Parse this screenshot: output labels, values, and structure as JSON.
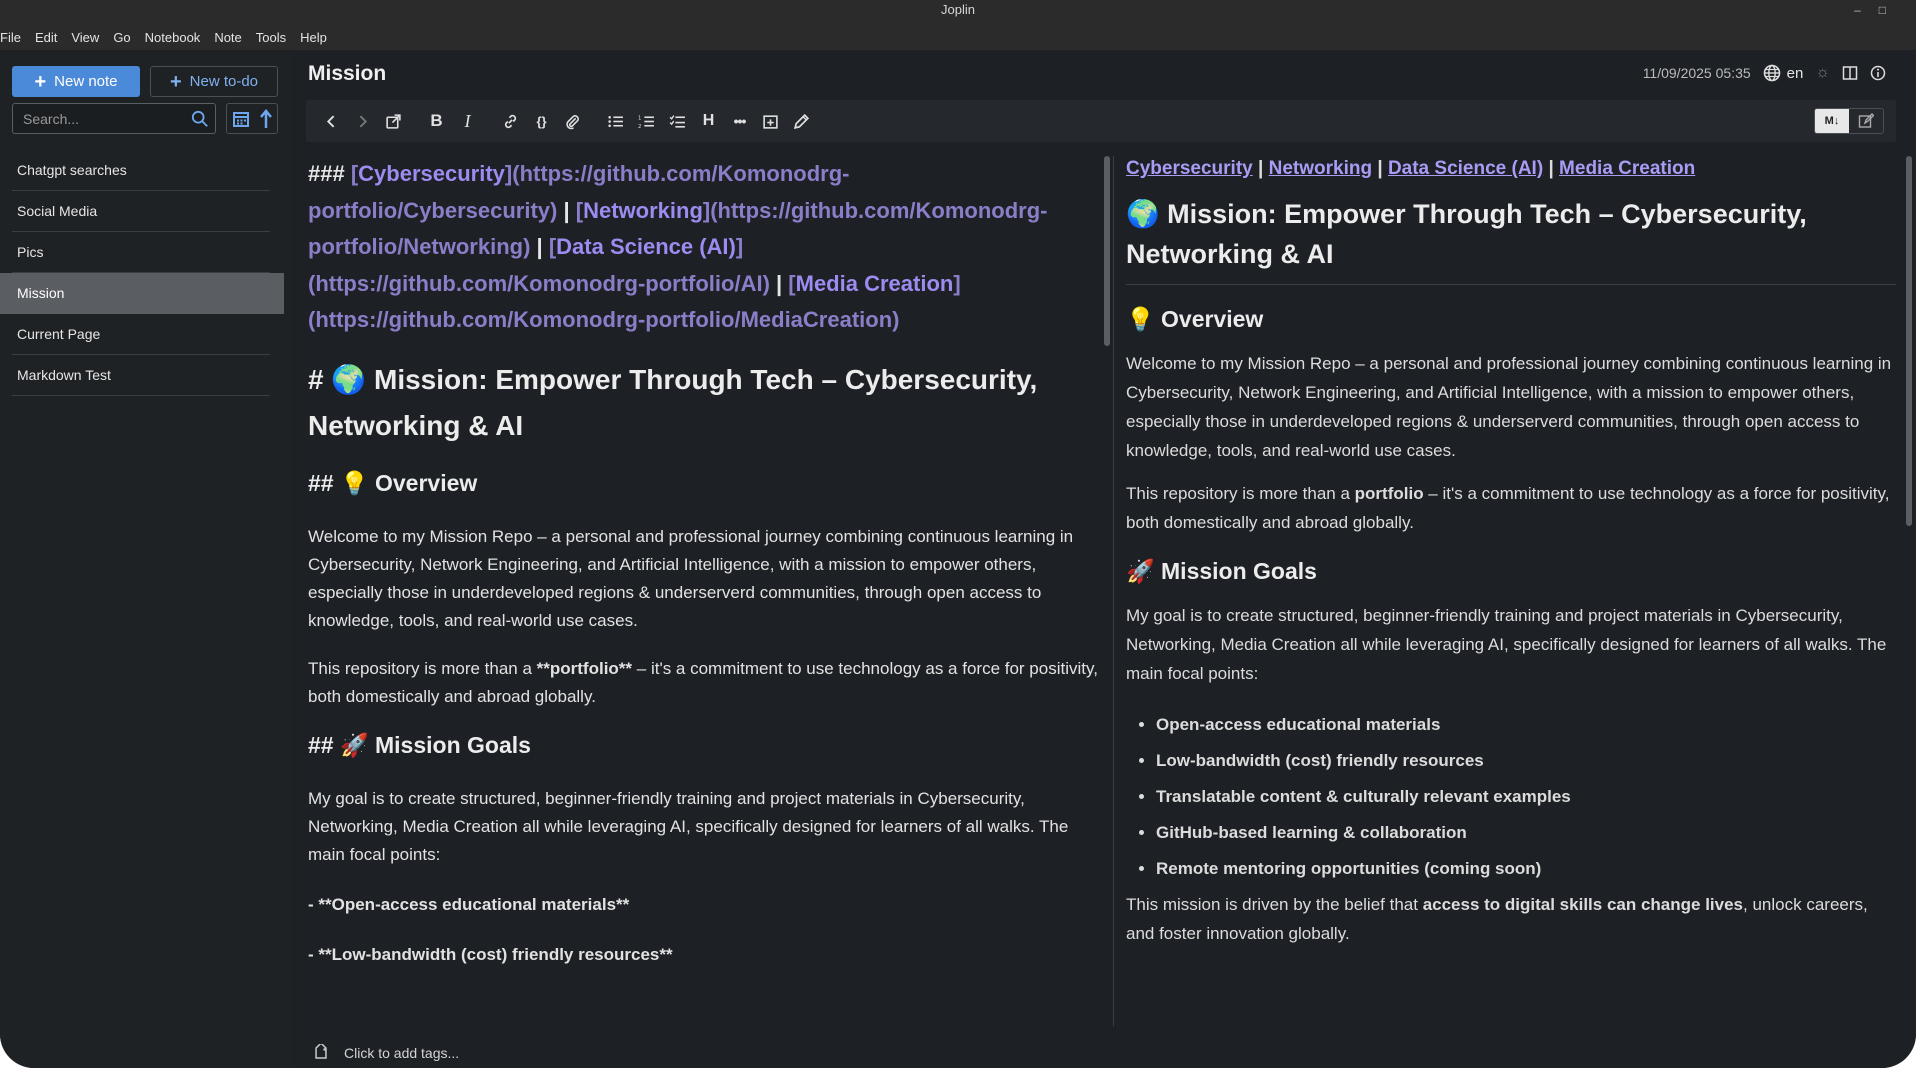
{
  "window": {
    "title": "Joplin"
  },
  "menu": [
    "File",
    "Edit",
    "View",
    "Go",
    "Notebook",
    "Note",
    "Tools",
    "Help"
  ],
  "sidebar": {
    "new_note_label": "New note",
    "new_todo_label": "New to-do",
    "search_placeholder": "Search...",
    "notes": [
      {
        "title": "Chatgpt searches",
        "selected": false
      },
      {
        "title": "Social Media",
        "selected": false
      },
      {
        "title": "Pics",
        "selected": false
      },
      {
        "title": "Mission",
        "selected": true
      },
      {
        "title": "Current Page",
        "selected": false
      },
      {
        "title": "Markdown Test",
        "selected": false
      }
    ]
  },
  "editor": {
    "title": "Mission",
    "timestamp": "11/09/2025 05:35",
    "language": "en",
    "toolbar_icons": [
      "back-icon",
      "forward-icon",
      "external-edit-icon",
      "bold-icon",
      "italic-icon",
      "link-icon",
      "code-icon",
      "attachment-icon",
      "bullet-list-icon",
      "numbered-list-icon",
      "checkbox-list-icon",
      "heading-icon",
      "horizontal-rule-icon",
      "insert-date-icon",
      "spellcheck-icon"
    ],
    "markdown": {
      "h3_prefix": "### ",
      "links": [
        {
          "text": "Cybersecurity",
          "url": "https://github.com/Komonodrg-portfolio/Cybersecurity"
        },
        {
          "text": "Networking",
          "url": "https://github.com/Komonodrg-portfolio/Networking"
        },
        {
          "text": "Data Science (AI)",
          "url": "https://github.com/Komonodrg-portfolio/AI"
        },
        {
          "text": "Media Creation",
          "url": "https://github.com/Komonodrg-portfolio/MediaCreation"
        }
      ],
      "h1": "# 🌍 Mission: Empower Through Tech – Cybersecurity, Networking & AI",
      "h2_overview": "## 💡 Overview",
      "p1": "Welcome to my Mission Repo – a personal and professional journey combining continuous learning in Cybersecurity, Network Engineering, and Artificial Intelligence, with a mission to empower others, especially those in underdeveloped regions & underserverd communities, through open access to knowledge, tools, and real-world use cases.",
      "p2_before": "This repository is more than a ",
      "p2_bold": "**portfolio**",
      "p2_after": " – it's a commitment to use technology as a force for positivity, both domestically and abroad globally.",
      "h2_goals": "## 🚀 Mission Goals",
      "p3": "My goal is to create structured, beginner-friendly training and project materials in Cybersecurity, Networking, Media Creation all while leveraging AI, specifically designed for learners of all walks. The main focal points:",
      "li1": "**Open-access educational materials**",
      "li2": "**Low-bandwidth (cost) friendly resources**"
    },
    "preview": {
      "links": [
        "Cybersecurity",
        "Networking",
        "Data Science (AI)",
        "Media Creation"
      ],
      "separator": " | ",
      "h1": "🌍 Mission: Empower Through Tech – Cybersecurity, Networking & AI",
      "h2_overview": "💡 Overview",
      "p1": "Welcome to my Mission Repo – a personal and professional journey combining continuous learning in Cybersecurity, Network Engineering, and Artificial Intelligence, with a mission to empower others, especially those in underdeveloped regions & underserverd communities, through open access to knowledge, tools, and real-world use cases.",
      "p2_before": "This repository is more than a ",
      "p2_bold": "portfolio",
      "p2_after": " – it's a commitment to use technology as a force for positivity, both domestically and abroad globally.",
      "h2_goals": "🚀 Mission Goals",
      "p3": "My goal is to create structured, beginner-friendly training and project materials in Cybersecurity, Networking, Media Creation all while leveraging AI, specifically designed for learners of all walks. The main focal points:",
      "list": [
        "Open-access educational materials",
        "Low-bandwidth (cost) friendly resources",
        "Translatable content & culturally relevant examples",
        "GitHub-based learning & collaboration",
        "Remote mentoring opportunities (coming soon)"
      ],
      "p4_before": "This mission is driven by the belief that ",
      "p4_bold": "access to digital skills can change lives",
      "p4_after": ", unlock careers, and foster innovation globally."
    },
    "tags_label": "Click to add tags..."
  }
}
